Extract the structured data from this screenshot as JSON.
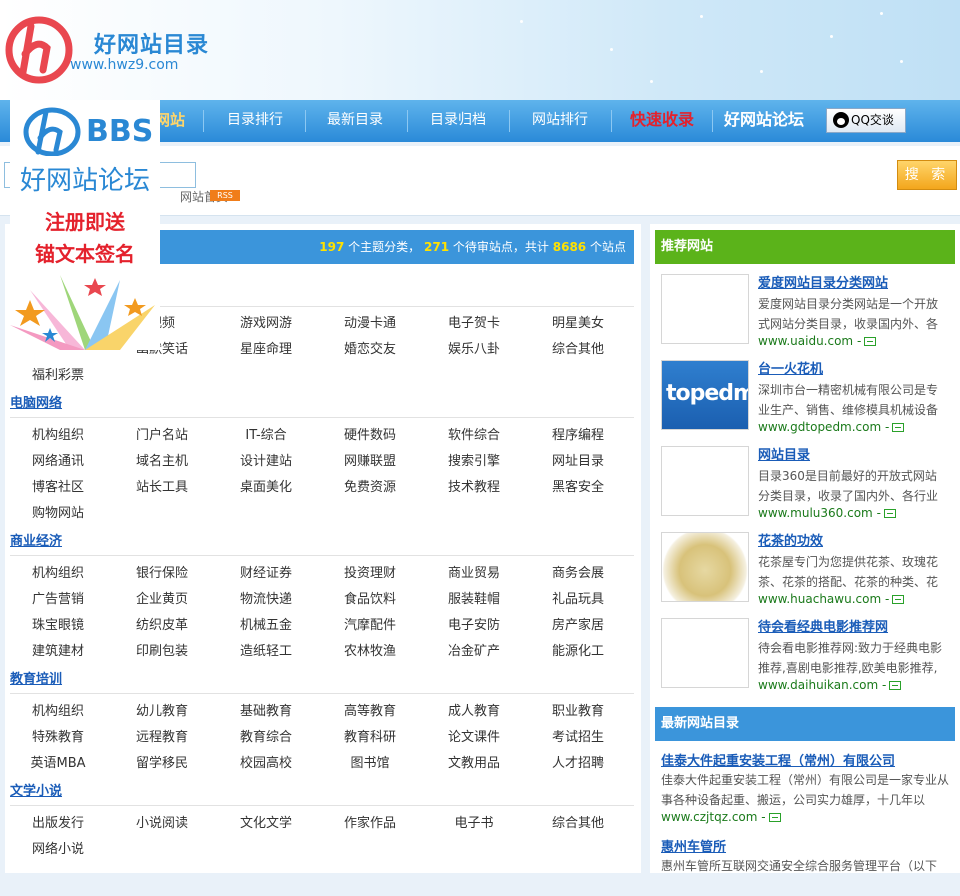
{
  "header": {
    "logo_name": "好网站目录",
    "logo_url": "www.hwz9.com"
  },
  "nav": {
    "items": [
      {
        "label": "网站",
        "style": "home"
      },
      {
        "label": "目录排行"
      },
      {
        "label": "最新目录"
      },
      {
        "label": "目录归档"
      },
      {
        "label": "网站排行"
      },
      {
        "label": "快速收录",
        "style": "red"
      },
      {
        "label": "好网站论坛",
        "style": "bold"
      }
    ],
    "qq_label": "QQ交谈"
  },
  "search": {
    "button_label": "搜 索",
    "input_value": "",
    "breadcrumb": "网站首页",
    "rss": "RSS"
  },
  "main": {
    "stats": {
      "categories": "197",
      "categories_label": "个主题分类，",
      "pending": "271",
      "pending_label": "个待审站点，共计",
      "sites": "8686",
      "sites_label": "个站点"
    },
    "top_rows": [
      [
        "",
        "视频",
        "游戏网游",
        "动漫卡通",
        "电子贺卡",
        "明星美女"
      ],
      [
        "",
        "幽默笑话",
        "星座命理",
        "婚恋交友",
        "娱乐八卦",
        "综合其他"
      ],
      [
        "福利彩票"
      ]
    ],
    "categories": [
      {
        "title": "电脑网络",
        "rows": [
          [
            "机构组织",
            "门户名站",
            "IT-综合",
            "硬件数码",
            "软件综合",
            "程序编程"
          ],
          [
            "网络通讯",
            "域名主机",
            "设计建站",
            "网赚联盟",
            "搜索引擎",
            "网址目录"
          ],
          [
            "博客社区",
            "站长工具",
            "桌面美化",
            "免费资源",
            "技术教程",
            "黑客安全"
          ],
          [
            "购物网站"
          ]
        ]
      },
      {
        "title": "商业经济",
        "rows": [
          [
            "机构组织",
            "银行保险",
            "财经证券",
            "投资理财",
            "商业贸易",
            "商务会展"
          ],
          [
            "广告营销",
            "企业黄页",
            "物流快递",
            "食品饮料",
            "服装鞋帽",
            "礼品玩具"
          ],
          [
            "珠宝眼镜",
            "纺织皮革",
            "机械五金",
            "汽摩配件",
            "电子安防",
            "房产家居"
          ],
          [
            "建筑建材",
            "印刷包装",
            "造纸轻工",
            "农林牧渔",
            "冶金矿产",
            "能源化工"
          ]
        ]
      },
      {
        "title": "教育培训",
        "rows": [
          [
            "机构组织",
            "幼儿教育",
            "基础教育",
            "高等教育",
            "成人教育",
            "职业教育"
          ],
          [
            "特殊教育",
            "远程教育",
            "教育综合",
            "教育科研",
            "论文课件",
            "考试招生"
          ],
          [
            "英语MBA",
            "留学移民",
            "校园高校",
            "图书馆",
            "文教用品",
            "人才招聘"
          ]
        ]
      },
      {
        "title": "文学小说",
        "rows": [
          [
            "出版发行",
            "小说阅读",
            "文化文学",
            "作家作品",
            "电子书",
            "综合其他"
          ],
          [
            "网络小说"
          ]
        ]
      }
    ]
  },
  "side": {
    "recommended_title": "推荐网站",
    "recommended": [
      {
        "title": "爱度网站目录分类网站",
        "desc": "爱度网站目录分类网站是一个开放式网站分类目录，收录国内外、各",
        "url": "www.uaidu.com",
        "thumb": "blank"
      },
      {
        "title": "台一火花机",
        "desc": "深圳市台一精密机械有限公司是专业生产、销售、维修模具机械设备",
        "url": "www.gdtopedm.com",
        "thumb": "topedm"
      },
      {
        "title": "网站目录",
        "desc": "目录360是目前最好的开放式网站分类目录，收录了国内外、各行业",
        "url": "www.mulu360.com",
        "thumb": "blank"
      },
      {
        "title": "花茶的功效",
        "desc": "花茶屋专门为您提供花茶、玫瑰花茶、花茶的搭配、花茶的种类、花",
        "url": "www.huachawu.com",
        "thumb": "tea"
      },
      {
        "title": "待会看经典电影推荐网",
        "desc": "待会看电影推荐网:致力于经典电影推荐,喜剧电影推荐,欧美电影推荐,",
        "url": "www.daihuikan.com",
        "thumb": "blank"
      }
    ],
    "thumb_text": "topedm",
    "new_title": "最新网站目录",
    "new_sites": [
      {
        "title": "佳泰大件起重安装工程（常州）有限公司",
        "desc": "佳泰大件起重安装工程（常州）有限公司是一家专业从事各种设备起重、搬运，公司实力雄厚，十几年以",
        "url": "www.czjtqz.com"
      },
      {
        "title": "惠州车管所",
        "desc": "惠州车管所互联网交通安全综合服务管理平台（以下",
        "url": ""
      }
    ]
  },
  "ad": {
    "bbs": "BBS",
    "name": "好网站论坛",
    "line1": "注册即送",
    "line2": "锚文本签名"
  },
  "colors": {
    "nav_blue": "#2a8ad8",
    "link_blue": "#1a5cb8",
    "green_head": "#5bb31a",
    "url_green": "#1b7a1b",
    "accent_red": "#e4212c",
    "stat_yellow": "#ffe100"
  }
}
